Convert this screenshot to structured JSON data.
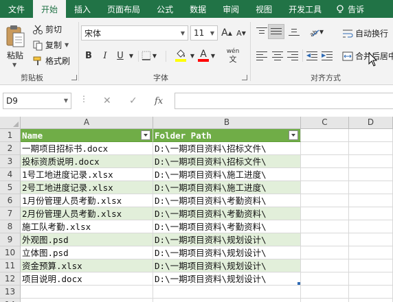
{
  "ribbon": {
    "tabs": [
      {
        "label": "文件"
      },
      {
        "label": "开始",
        "active": true
      },
      {
        "label": "插入"
      },
      {
        "label": "页面布局"
      },
      {
        "label": "公式"
      },
      {
        "label": "数据"
      },
      {
        "label": "审阅"
      },
      {
        "label": "视图"
      },
      {
        "label": "开发工具"
      },
      {
        "label": "告诉"
      }
    ],
    "clipboard": {
      "paste": "粘贴",
      "cut": "剪切",
      "copy": "复制",
      "format_painter": "格式刷",
      "group_label": "剪贴板"
    },
    "font": {
      "name": "宋体",
      "size": "11",
      "bold": "B",
      "italic": "I",
      "underline": "U",
      "phonetic_top": "wén",
      "phonetic_bottom": "文",
      "font_color_glyph": "A",
      "grow_glyph": "A",
      "shrink_glyph": "A",
      "group_label": "字体"
    },
    "alignment": {
      "wrap_text": "自动换行",
      "merge_center": "合并后居中",
      "group_label": "对齐方式"
    },
    "colors": {
      "brand": "#217346",
      "fill_highlight": "#ffff00",
      "font_color": "#ff0000"
    }
  },
  "formula_bar": {
    "name_box": "D9",
    "cancel": "✕",
    "enter": "✓",
    "fx": "fx",
    "formula": ""
  },
  "sheet": {
    "columns": [
      "A",
      "B",
      "C",
      "D"
    ],
    "rows": [
      "1",
      "2",
      "3",
      "4",
      "5",
      "6",
      "7",
      "8",
      "9",
      "10",
      "11",
      "12",
      "13",
      "14"
    ],
    "header": [
      "Name",
      "Folder Path"
    ],
    "data": [
      [
        "一期项目招标书.docx",
        "D:\\一期项目资料\\招标文件\\"
      ],
      [
        "投标资质说明.docx",
        "D:\\一期项目资料\\招标文件\\"
      ],
      [
        "1号工地进度记录.xlsx",
        "D:\\一期项目资料\\施工进度\\"
      ],
      [
        "2号工地进度记录.xlsx",
        "D:\\一期项目资料\\施工进度\\"
      ],
      [
        "1月份管理人员考勤.xlsx",
        "D:\\一期项目资料\\考勤资料\\"
      ],
      [
        "2月份管理人员考勤.xlsx",
        "D:\\一期项目资料\\考勤资料\\"
      ],
      [
        "施工队考勤.xlsx",
        "D:\\一期项目资料\\考勤资料\\"
      ],
      [
        "外观图.psd",
        "D:\\一期项目资料\\规划设计\\"
      ],
      [
        "立体图.psd",
        "D:\\一期项目资料\\规划设计\\"
      ],
      [
        "资金预算.xlsx",
        "D:\\一期项目资料\\规划设计\\"
      ],
      [
        "项目说明.docx",
        "D:\\一期项目资料\\规划设计\\"
      ]
    ],
    "colors": {
      "table_header": "#70ad47",
      "band": "#e2efda"
    }
  }
}
